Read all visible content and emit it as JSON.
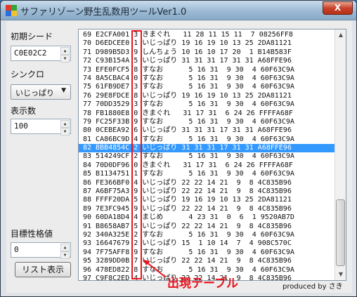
{
  "window": {
    "title": "サファリゾーン野生乱数用ツールVer1.0",
    "close_label": "X"
  },
  "seed": {
    "label": "初期シード",
    "value": "C0E02C2"
  },
  "sync": {
    "label": "シンクロ",
    "value": "いじっぱり"
  },
  "count": {
    "label": "表示数",
    "value": "100"
  },
  "target": {
    "label": "目標性格値",
    "value": "0"
  },
  "list_button": {
    "label": "リスト表示"
  },
  "list": {
    "selected_index": 13,
    "rows": [
      "69 E2CFA001 3 きまぐれ   11 28 11 15 11  7 08256FF8",
      "70 D6EDCEE0 1 いじっぱり 19 16 19 10 13 25 2DA81121",
      "71 D989B5D3 9 しんちょう 10 16 10 17 20  1 B14B583F",
      "72 C93B154A 5 いじっぱり 31 31 31 17 31 31 A68FFE96",
      "73 EFE0FCF5 8 すなお      5 16 31  9 30  4 60F63C9A",
      "74 8A5CBAC4 0 すなお      5 16 31  9 30  4 60F63C9A",
      "75 61FB9DE7 3 すなお      5 16 31  9 30  4 60F63C9A",
      "76 29E8FDCE 8 いじっぱり 19 16 19 10 13 25 2DA81121",
      "77 70DD3529 3 すなお      5 16 31  9 30  4 60F63C9A",
      "78 FB1880E8 0 きまぐれ   31 17 31  6 24 26 FFFFA68F",
      "79 FC25F33B 9 すなお      5 16 31  9 30  4 60F63C9A",
      "80 0CEBEA92 6 いじっぱり 31 31 31 17 31 31 A68FFE96",
      "81 CA86BC9D 4 すなお      5 16 31  9 30  4 60F63C9A",
      "82 BBB4854C 2 いじっぱり 31 31 31 17 31 31 A68FFE96",
      "83 514249CF 2 すなお      5 16 31  9 30  4 60F63C9A",
      "84 70D0DF96 0 きまぐれ   31 17 31  6 24 26 FFFFA68F",
      "85 B1134751 1 すなお      5 16 31  9 30  4 60F63C9A",
      "86 FE366BF0 4 いじっぱり 22 22 14 21  9  8 4C835B96",
      "87 A6BF75A3 9 いじっぱり 22 22 14 21  9  8 4C835B96",
      "88 FFFF20DA 5 いじっぱり 19 16 19 10 13 25 2DA81121",
      "89 7E3FC945 9 いじっぱり 22 22 14 21  9  8 4C835B96",
      "90 60DA18D4 4 まじめ      4 23 31  0  6  1 9520AB7D",
      "91 B8658AB7 5 いじっぱり 22 22 14 21  9  8 4C835B96",
      "92 340A325E 2 すなお      5 16 31  9 30  4 60F63C9A",
      "93 16647679 2 いじっぱり 15  1 10 14  7  4 908C570C",
      "94 7F75AFF8 9 すなお      5 16 31  9 30  4 60F63C9A",
      "95 3289DD0B 7 いじっぱり 22 22 14 21  9  8 4C835B96",
      "96 478ED822 8 すなお      5 16 31  9 30  4 60F63C9A",
      "97 C9F8C2ED 4 いじっぱり 22 22 14 21  9  8 4C835B96"
    ]
  },
  "annotation": {
    "label": "出現テーブル",
    "color": "#e8141e"
  },
  "credit": {
    "text": "produced by さき"
  },
  "icons": {
    "up": "▲",
    "down": "▼",
    "dropdown": "▼"
  },
  "colors": {
    "selection": "#3399ff",
    "annotation": "#e8141e"
  }
}
